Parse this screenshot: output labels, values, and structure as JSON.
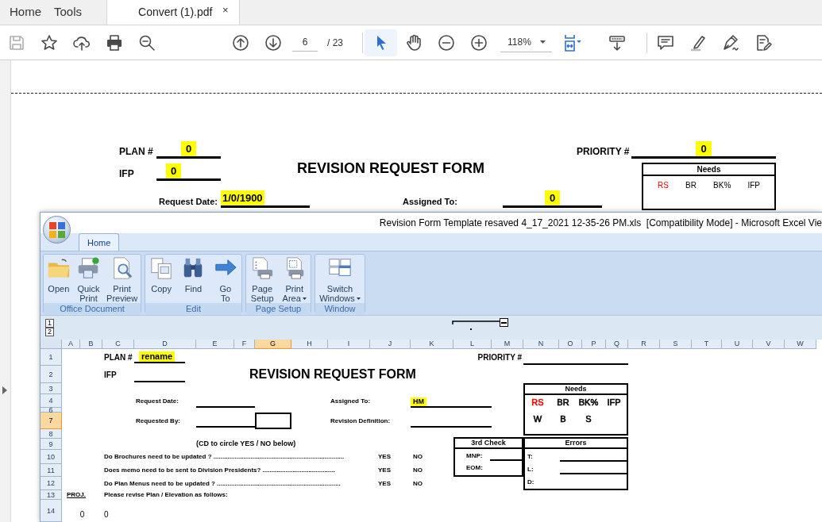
{
  "pdf_tabs": [
    {
      "label": "Home",
      "selected": false
    },
    {
      "label": "Tools",
      "selected": false
    },
    {
      "label": "Convert (1).pdf",
      "selected": true,
      "close": "×"
    }
  ],
  "toolbar": {
    "groups": [
      [
        {
          "kind": "save",
          "disabled": true
        },
        {
          "kind": "bookmark"
        },
        {
          "kind": "upload"
        },
        {
          "kind": "print"
        },
        {
          "kind": "find"
        }
      ],
      [
        {
          "kind": "prev"
        },
        {
          "kind": "next"
        },
        {
          "kind": "page_field",
          "value": "6",
          "total": "/ 23"
        }
      ],
      [
        {
          "kind": "select",
          "selected": true
        },
        {
          "kind": "hand",
          "selected": false
        },
        {
          "kind": "zoom_out"
        },
        {
          "kind": "zoom_in"
        },
        {
          "kind": "zoom_field",
          "value": "118%"
        },
        {
          "kind": "fit"
        },
        {
          "kind": "scroll"
        }
      ],
      [
        {
          "kind": "comment"
        },
        {
          "kind": "highlight"
        },
        {
          "kind": "sign"
        },
        {
          "kind": "edit"
        }
      ]
    ]
  },
  "pdf_page": {
    "plan_label": "PLAN #",
    "plan_value": "0",
    "ifp_label": "IFP",
    "ifp_value": "0",
    "title": "REVISION REQUEST FORM",
    "priority_label": "PRIORITY #",
    "priority_value": "0",
    "request_date_label": "Request Date:",
    "request_date_value": "1/0/1900",
    "assigned_label": "Assigned To:",
    "assigned_value": "0",
    "needs_title": "Needs",
    "needs": [
      {
        "label": "RS",
        "color": "#ff0000"
      },
      {
        "label": "BR",
        "color": "#000000"
      },
      {
        "label": "BK%",
        "color": "#000000"
      },
      {
        "label": "IFP",
        "color": "#000000"
      }
    ]
  },
  "excel": {
    "title": "Revision Form Template resaved 4_17_2021 12-35-26 PM.xls  [Compatibility Mode] - Microsoft Excel Vie",
    "ribbon_tabs": [
      {
        "label": "Home",
        "selected": true
      }
    ],
    "groups": [
      {
        "name": "Office Document",
        "buttons": [
          {
            "kind": "open",
            "lines": [
              "Open"
            ]
          },
          {
            "kind": "quick_print",
            "lines": [
              "Quick",
              "Print"
            ]
          },
          {
            "kind": "print_preview",
            "lines": [
              "Print",
              "Preview"
            ]
          }
        ]
      },
      {
        "name": "Edit",
        "buttons": [
          {
            "kind": "copy",
            "lines": [
              "Copy"
            ]
          },
          {
            "kind": "find",
            "lines": [
              "Find"
            ]
          },
          {
            "kind": "goto",
            "lines": [
              "Go",
              "To"
            ]
          }
        ]
      },
      {
        "name": "Page Setup",
        "buttons": [
          {
            "kind": "page_setup",
            "lines": [
              "Page",
              "Setup"
            ]
          },
          {
            "kind": "print_area",
            "lines": [
              "Print",
              "Area"
            ],
            "dropdown": true
          }
        ]
      },
      {
        "name": "Window",
        "buttons": [
          {
            "kind": "switch_windows",
            "lines": [
              "Switch",
              "Windows"
            ],
            "dropdown": true
          }
        ]
      }
    ],
    "outline_levels": [
      "1",
      "2"
    ],
    "columns": [
      {
        "label": "A",
        "selected": false
      },
      {
        "label": "B",
        "selected": false
      },
      {
        "label": "C",
        "selected": false
      },
      {
        "label": "D",
        "selected": false
      },
      {
        "label": "E",
        "selected": false
      },
      {
        "label": "F",
        "selected": false
      },
      {
        "label": "G",
        "selected": true
      },
      {
        "label": "H",
        "selected": false
      },
      {
        "label": "I",
        "selected": false
      },
      {
        "label": "J",
        "selected": false
      },
      {
        "label": "K",
        "selected": false
      },
      {
        "label": "L",
        "selected": false
      },
      {
        "label": "M",
        "selected": false
      },
      {
        "label": "N",
        "selected": false
      },
      {
        "label": "O",
        "selected": false
      },
      {
        "label": "P",
        "selected": false
      },
      {
        "label": "Q",
        "selected": false
      },
      {
        "label": "R",
        "selected": false
      },
      {
        "label": "S",
        "selected": false
      },
      {
        "label": "T",
        "selected": false
      },
      {
        "label": "U",
        "selected": false
      },
      {
        "label": "V",
        "selected": false
      },
      {
        "label": "W",
        "selected": false
      }
    ],
    "rows": [
      {
        "label": "1",
        "selected": false
      },
      {
        "label": "2",
        "selected": false
      },
      {
        "label": "3",
        "selected": false
      },
      {
        "label": "4",
        "selected": false
      },
      {
        "label": "6",
        "selected": false
      },
      {
        "label": "7",
        "selected": true
      },
      {
        "label": "8",
        "selected": false
      },
      {
        "label": "9",
        "selected": false
      },
      {
        "label": "10",
        "selected": false
      },
      {
        "label": "11",
        "selected": false
      },
      {
        "label": "12",
        "selected": false
      },
      {
        "label": "13",
        "selected": false
      },
      {
        "label": "14",
        "selected": false
      }
    ],
    "sheet": {
      "plan_label": "PLAN #",
      "plan_value": "rename",
      "ifp_label": "IFP",
      "title": "REVISION REQUEST FORM",
      "priority_label": "PRIORITY #",
      "request_date_label": "Request Date:",
      "assigned_label": "Assigned To:",
      "assigned_value": "HM",
      "requested_by_label": "Requested By:",
      "revision_definition_label": "Revision Definition:",
      "needs_title": "Needs",
      "needs": [
        {
          "label": "RS",
          "color": "#ff0000"
        },
        {
          "label": "BR",
          "color": "#000000"
        },
        {
          "label": "BK%",
          "color": "#000000"
        },
        {
          "label": "IFP",
          "color": "#000000"
        },
        {
          "label": "W",
          "color": "#000000"
        },
        {
          "label": "B",
          "color": "#000000"
        },
        {
          "label": "S",
          "color": "#000000"
        }
      ],
      "circle_note": "(CD to circle YES / NO below)",
      "questions": [
        {
          "text": "Do Brochures need to be updated ? ..........................................................................",
          "yes": "YES",
          "no": "NO"
        },
        {
          "text": "Does memo need to be sent to Division Presidents? .........................................",
          "yes": "YES",
          "no": "NO"
        },
        {
          "text": "Do Plan Menus need to be updated ? ......................................................................",
          "yes": "YES",
          "no": "NO"
        }
      ],
      "third_check_title": "3rd Check",
      "third_check": [
        "MNP:",
        "EOM:"
      ],
      "errors_title": "Errors",
      "errors": [
        "T:",
        "L:",
        "D:"
      ],
      "proj_label": "PROJ.",
      "revise_note": "Please revise Plan / Elevation as follows:",
      "row14": [
        "0",
        "0"
      ]
    }
  }
}
